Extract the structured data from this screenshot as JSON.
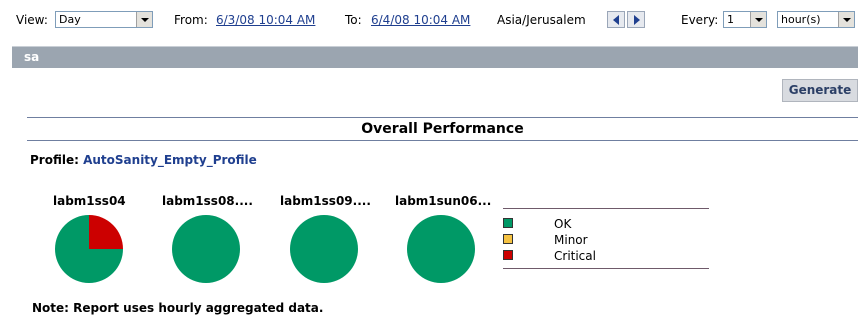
{
  "toolbar": {
    "view_label": "View:",
    "view_value": "Day",
    "from_label": "From:",
    "from_value": "6/3/08 10:04 AM",
    "to_label": "To:",
    "to_value": "6/4/08 10:04 AM",
    "timezone": "Asia/Jerusalem",
    "every_label": "Every:",
    "every_value": "1",
    "unit_value": "hour(s)"
  },
  "section": {
    "title": "sa"
  },
  "generate_label": "Generate",
  "report": {
    "title": "Overall Performance",
    "profile_label": "Profile:",
    "profile_name": "AutoSanity_Empty_Profile",
    "note": "Note: Report uses hourly aggregated data."
  },
  "hosts": [
    {
      "name": "labm1ss04",
      "ok": 0.75,
      "critical": 0.25
    },
    {
      "name": "labm1ss08....",
      "ok": 1.0,
      "critical": 0
    },
    {
      "name": "labm1ss09....",
      "ok": 1.0,
      "critical": 0
    },
    {
      "name": "labm1sun06...",
      "ok": 1.0,
      "critical": 0
    }
  ],
  "legend": [
    {
      "label": "OK",
      "color": "#009966"
    },
    {
      "label": "Minor",
      "color": "#f5c242"
    },
    {
      "label": "Critical",
      "color": "#cc0000"
    }
  ]
}
